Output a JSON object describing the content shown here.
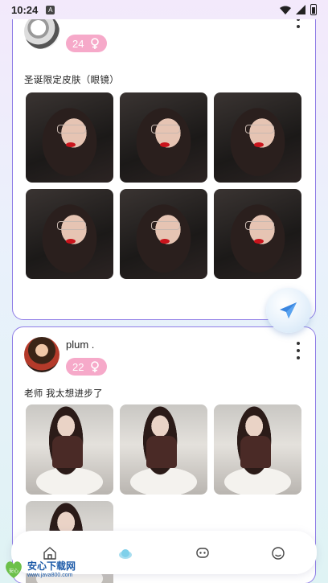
{
  "status_bar": {
    "time": "10:24",
    "sim_badge": "A"
  },
  "posts": [
    {
      "username": "",
      "age": "24",
      "text": "圣诞限定皮肤（眼镜）",
      "photos": 6
    },
    {
      "username": "plum .",
      "age": "22",
      "text": "老师 我太想进步了",
      "photos": 4
    }
  ],
  "colors": {
    "card_border": "#8f7de6",
    "badge_bg": "#f6a9c9",
    "nav_active": "#7fd0ea"
  },
  "bottom_nav": {
    "items": [
      "home-icon",
      "planet-icon",
      "chat-icon",
      "profile-icon"
    ],
    "active_index": 1
  },
  "watermark": {
    "title": "安心下载网",
    "url": "www.java800.com",
    "badge": "安心"
  }
}
